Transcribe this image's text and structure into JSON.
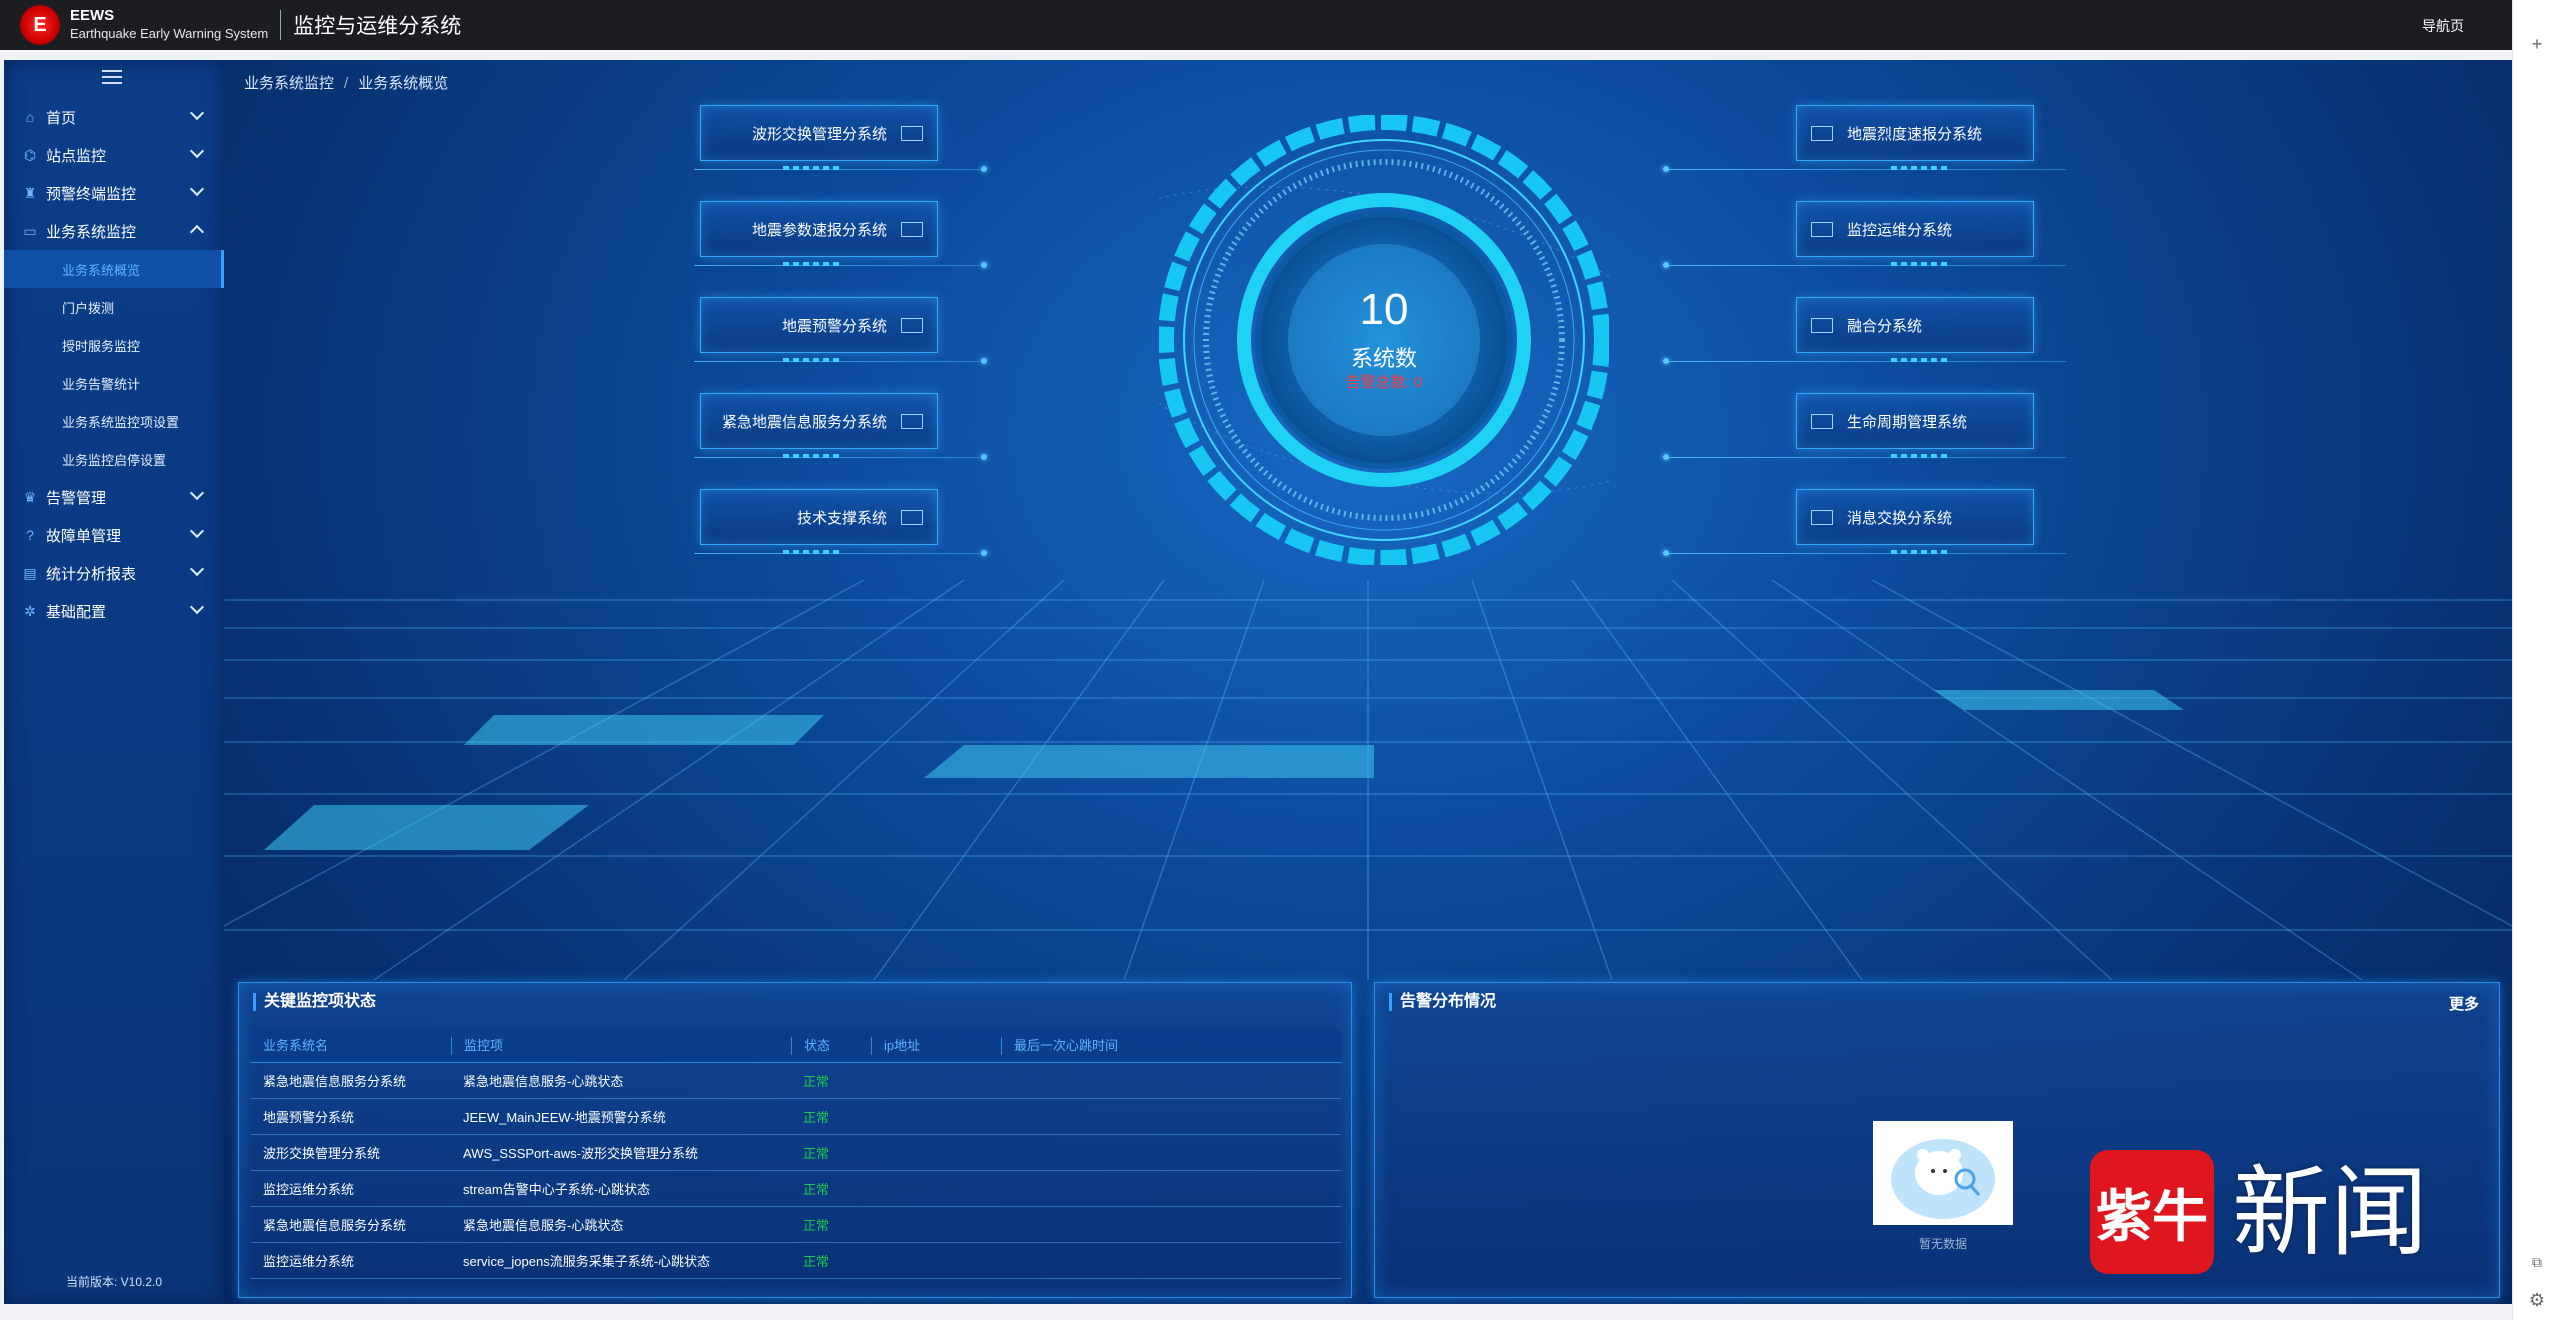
{
  "header": {
    "logo_glyph": "E",
    "abbr": "EEWS",
    "full_name": "Earthquake Early Warning System",
    "title": "监控与运维分系统",
    "nav_link": "导航页"
  },
  "sidebar": {
    "items": [
      {
        "label": "首页",
        "icon": "home-icon",
        "glyph": "⌂"
      },
      {
        "label": "站点监控",
        "icon": "station-icon",
        "glyph": "⌬"
      },
      {
        "label": "预警终端监控",
        "icon": "terminal-icon",
        "glyph": "♜"
      },
      {
        "label": "业务系统监控",
        "icon": "monitor-icon",
        "glyph": "▭"
      },
      {
        "label": "告警管理",
        "icon": "alarm-icon",
        "glyph": "♛"
      },
      {
        "label": "故障单管理",
        "icon": "question-icon",
        "glyph": "?"
      },
      {
        "label": "统计分析报表",
        "icon": "report-icon",
        "glyph": "▤"
      },
      {
        "label": "基础配置",
        "icon": "gear-icon",
        "glyph": "✲"
      }
    ],
    "sub_items": [
      "业务系统概览",
      "门户拨测",
      "授时服务监控",
      "业务告警统计",
      "业务系统监控项设置",
      "业务监控启停设置"
    ],
    "version": "当前版本: V10.2.0"
  },
  "breadcrumb": {
    "parent": "业务系统监控",
    "separator": "/",
    "current": "业务系统概览"
  },
  "subsystems_left": [
    "波形交换管理分系统",
    "地震参数速报分系统",
    "地震预警分系统",
    "紧急地震信息服务分系统",
    "技术支撑系统"
  ],
  "subsystems_right": [
    "地震烈度速报分系统",
    "监控运维分系统",
    "融合分系统",
    "生命周期管理系统",
    "消息交换分系统"
  ],
  "summary": {
    "count": "10",
    "label": "系统数",
    "alarm_text": "告警总数: 0"
  },
  "monitor_panel": {
    "title": "关键监控项状态",
    "columns": [
      "业务系统名",
      "监控项",
      "状态",
      "ip地址",
      "最后一次心跳时间"
    ],
    "rows": [
      [
        "紧急地震信息服务分系统",
        "紧急地震信息服务-心跳状态",
        "正常",
        "",
        ""
      ],
      [
        "地震预警分系统",
        "JEEW_MainJEEW-地震预警分系统",
        "正常",
        "",
        ""
      ],
      [
        "波形交换管理分系统",
        "AWS_SSSPort-aws-波形交换管理分系统",
        "正常",
        "",
        ""
      ],
      [
        "监控运维分系统",
        "stream告警中心子系统-心跳状态",
        "正常",
        "",
        ""
      ],
      [
        "紧急地震信息服务分系统",
        "紧急地震信息服务-心跳状态",
        "正常",
        "",
        ""
      ],
      [
        "监控运维分系统",
        "service_jopens流服务采集子系统-心跳状态",
        "正常",
        "",
        ""
      ]
    ]
  },
  "alarm_panel": {
    "title": "告警分布情况",
    "more": "更多",
    "empty_text": "暂无数据"
  },
  "watermark": {
    "badge": "紫牛",
    "text": "新闻"
  },
  "colors": {
    "accent": "#3aa0ff",
    "ok": "#19c94a",
    "alarm": "#ff3b3b",
    "header_bg": "#1b1d22"
  }
}
